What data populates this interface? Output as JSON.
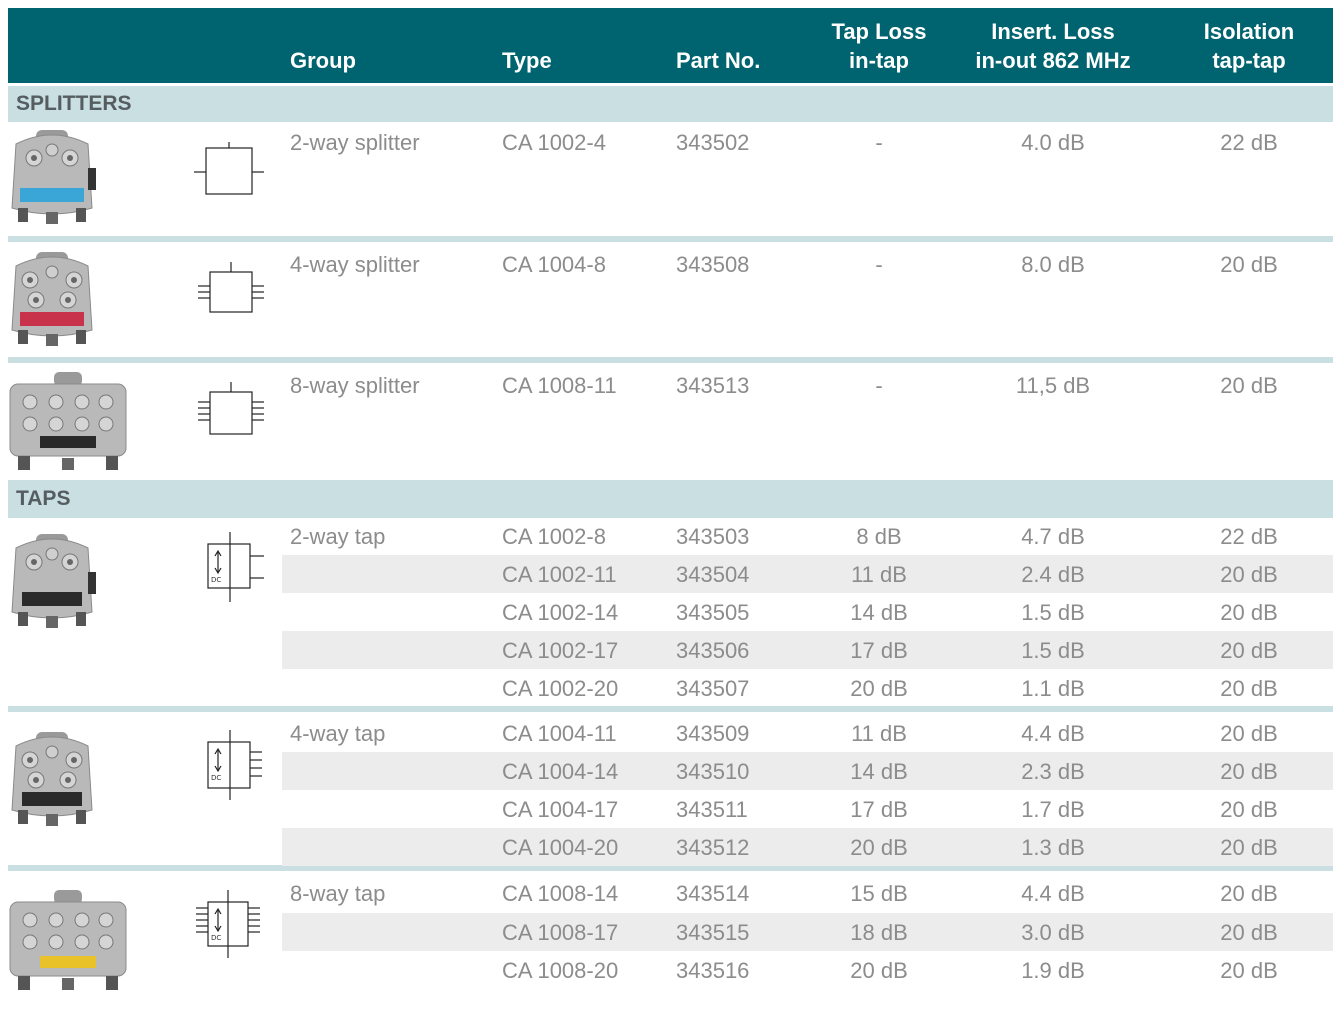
{
  "header": {
    "group": "Group",
    "type": "Type",
    "part": "Part No.",
    "tap_loss": [
      "Tap Loss",
      "in-tap"
    ],
    "insert_loss": [
      "Insert. Loss",
      "in-out 862 MHz"
    ],
    "isolation": [
      "Isolation",
      "tap-tap"
    ]
  },
  "sections": {
    "splitters": "SPLITTERS",
    "taps": "TAPS"
  },
  "groups": [
    {
      "name": "2-way splitter",
      "rows": [
        {
          "type": "CA 1002-4",
          "part": "343502",
          "tap": "-",
          "ins": "4.0 dB",
          "iso": "22 dB"
        }
      ]
    },
    {
      "name": "4-way splitter",
      "rows": [
        {
          "type": "CA 1004-8",
          "part": "343508",
          "tap": "-",
          "ins": "8.0 dB",
          "iso": "20 dB"
        }
      ]
    },
    {
      "name": "8-way splitter",
      "rows": [
        {
          "type": "CA 1008-11",
          "part": "343513",
          "tap": "-",
          "ins": "11,5 dB",
          "iso": "20 dB"
        }
      ]
    },
    {
      "name": "2-way tap",
      "rows": [
        {
          "type": "CA 1002-8",
          "part": "343503",
          "tap": "8 dB",
          "ins": "4.7 dB",
          "iso": "22 dB"
        },
        {
          "type": "CA 1002-11",
          "part": "343504",
          "tap": "11 dB",
          "ins": "2.4 dB",
          "iso": "20 dB"
        },
        {
          "type": "CA 1002-14",
          "part": "343505",
          "tap": "14 dB",
          "ins": "1.5 dB",
          "iso": "20 dB"
        },
        {
          "type": "CA 1002-17",
          "part": "343506",
          "tap": "17 dB",
          "ins": "1.5 dB",
          "iso": "20 dB"
        },
        {
          "type": "CA 1002-20",
          "part": "343507",
          "tap": "20 dB",
          "ins": "1.1 dB",
          "iso": "20 dB"
        }
      ]
    },
    {
      "name": "4-way tap",
      "rows": [
        {
          "type": "CA 1004-11",
          "part": "343509",
          "tap": "11 dB",
          "ins": "4.4 dB",
          "iso": "20 dB"
        },
        {
          "type": "CA 1004-14",
          "part": "343510",
          "tap": "14 dB",
          "ins": "2.3 dB",
          "iso": "20 dB"
        },
        {
          "type": "CA 1004-17",
          "part": "343511",
          "tap": "17 dB",
          "ins": "1.7 dB",
          "iso": "20 dB"
        },
        {
          "type": "CA 1004-20",
          "part": "343512",
          "tap": "20 dB",
          "ins": "1.3 dB",
          "iso": "20 dB"
        }
      ]
    },
    {
      "name": "8-way tap",
      "rows": [
        {
          "type": "CA 1008-14",
          "part": "343514",
          "tap": "15 dB",
          "ins": "4.4 dB",
          "iso": "20 dB"
        },
        {
          "type": "CA 1008-17",
          "part": "343515",
          "tap": "18 dB",
          "ins": "3.0 dB",
          "iso": "20 dB"
        },
        {
          "type": "CA 1008-20",
          "part": "343516",
          "tap": "20 dB",
          "ins": "1.9 dB",
          "iso": "20 dB"
        }
      ]
    }
  ],
  "symbol_label": "DC",
  "label_colors": {
    "2-way splitter": "#3aa6d8",
    "4-way splitter": "#c8324a",
    "8-way tap": "#e9c22a"
  }
}
